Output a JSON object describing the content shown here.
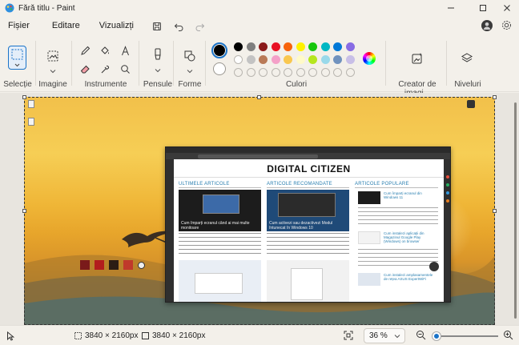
{
  "window": {
    "title": "Fără titlu - Paint",
    "controls": [
      "minimize-icon",
      "maximize-icon",
      "close-icon"
    ]
  },
  "menu": {
    "items": [
      "Fișier",
      "Editare",
      "Vizualizți"
    ],
    "icons": [
      "save-icon",
      "undo-icon",
      "redo-icon"
    ],
    "right_icons": [
      "account-avatar",
      "settings-icon"
    ]
  },
  "ribbon": {
    "groups": {
      "selection": "Selecție",
      "image": "Imagine",
      "tools": "Instrumente",
      "brushes": "Pensule",
      "shapes": "Forme",
      "colors": "Culori",
      "creator": "Creator de imagi...",
      "layers": "Niveluri"
    },
    "colors": {
      "primary": "#000000",
      "secondary": "#ffffff",
      "row1": [
        "#000000",
        "#7f7f7f",
        "#8b1a1a",
        "#e81123",
        "#f7630c",
        "#fff100",
        "#16c60c",
        "#00b7c3",
        "#0078d7",
        "#886ce4"
      ],
      "row2": [
        "#ffffff",
        "#c3c3c3",
        "#b97a57",
        "#f4a0c8",
        "#f9c74f",
        "#fffac8",
        "#b5e61d",
        "#99d9ea",
        "#7092be",
        "#c8bfe7"
      ]
    }
  },
  "canvas": {
    "background_desc_colors": [
      "#f2c04a",
      "#e7a52b",
      "#5e6d63"
    ],
    "browser": {
      "site_name": "DIGITAL CITIZEN",
      "columns": [
        "ULTIMELE ARTICOLE",
        "ARTICOLE RECOMANDATE",
        "ARTICOLE POPULARE"
      ],
      "headlines": [
        "Cum împarți ecranul când ai mai multe monitoare",
        "Cum activezi sau dezactivezi Modul întunecat în Windows 10",
        "Cum împarți ecranul din Windows 11",
        "Cum instalezi aplicații din Magazinul Google Play (Windows) on browser",
        "Cum instalezi amplasamentele de rețea ASUS ExpertWiFi"
      ]
    }
  },
  "status": {
    "image_size": "3840 × 2160px",
    "canvas_size": "3840 × 2160px",
    "zoom": "36 %",
    "zoom_fraction": 0.06
  }
}
